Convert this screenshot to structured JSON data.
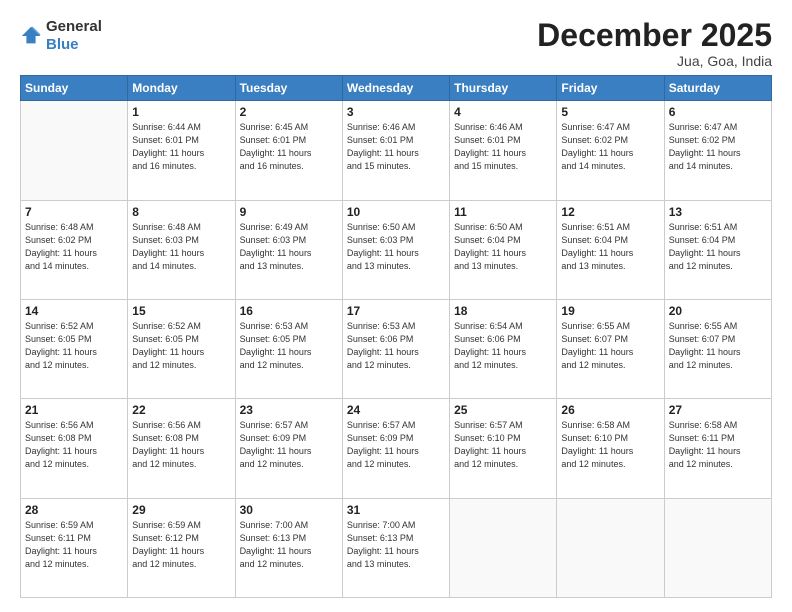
{
  "header": {
    "logo_general": "General",
    "logo_blue": "Blue",
    "month": "December 2025",
    "location": "Jua, Goa, India"
  },
  "weekdays": [
    "Sunday",
    "Monday",
    "Tuesday",
    "Wednesday",
    "Thursday",
    "Friday",
    "Saturday"
  ],
  "weeks": [
    [
      {
        "day": "",
        "info": ""
      },
      {
        "day": "1",
        "info": "Sunrise: 6:44 AM\nSunset: 6:01 PM\nDaylight: 11 hours\nand 16 minutes."
      },
      {
        "day": "2",
        "info": "Sunrise: 6:45 AM\nSunset: 6:01 PM\nDaylight: 11 hours\nand 16 minutes."
      },
      {
        "day": "3",
        "info": "Sunrise: 6:46 AM\nSunset: 6:01 PM\nDaylight: 11 hours\nand 15 minutes."
      },
      {
        "day": "4",
        "info": "Sunrise: 6:46 AM\nSunset: 6:01 PM\nDaylight: 11 hours\nand 15 minutes."
      },
      {
        "day": "5",
        "info": "Sunrise: 6:47 AM\nSunset: 6:02 PM\nDaylight: 11 hours\nand 14 minutes."
      },
      {
        "day": "6",
        "info": "Sunrise: 6:47 AM\nSunset: 6:02 PM\nDaylight: 11 hours\nand 14 minutes."
      }
    ],
    [
      {
        "day": "7",
        "info": "Sunrise: 6:48 AM\nSunset: 6:02 PM\nDaylight: 11 hours\nand 14 minutes."
      },
      {
        "day": "8",
        "info": "Sunrise: 6:48 AM\nSunset: 6:03 PM\nDaylight: 11 hours\nand 14 minutes."
      },
      {
        "day": "9",
        "info": "Sunrise: 6:49 AM\nSunset: 6:03 PM\nDaylight: 11 hours\nand 13 minutes."
      },
      {
        "day": "10",
        "info": "Sunrise: 6:50 AM\nSunset: 6:03 PM\nDaylight: 11 hours\nand 13 minutes."
      },
      {
        "day": "11",
        "info": "Sunrise: 6:50 AM\nSunset: 6:04 PM\nDaylight: 11 hours\nand 13 minutes."
      },
      {
        "day": "12",
        "info": "Sunrise: 6:51 AM\nSunset: 6:04 PM\nDaylight: 11 hours\nand 13 minutes."
      },
      {
        "day": "13",
        "info": "Sunrise: 6:51 AM\nSunset: 6:04 PM\nDaylight: 11 hours\nand 12 minutes."
      }
    ],
    [
      {
        "day": "14",
        "info": "Sunrise: 6:52 AM\nSunset: 6:05 PM\nDaylight: 11 hours\nand 12 minutes."
      },
      {
        "day": "15",
        "info": "Sunrise: 6:52 AM\nSunset: 6:05 PM\nDaylight: 11 hours\nand 12 minutes."
      },
      {
        "day": "16",
        "info": "Sunrise: 6:53 AM\nSunset: 6:05 PM\nDaylight: 11 hours\nand 12 minutes."
      },
      {
        "day": "17",
        "info": "Sunrise: 6:53 AM\nSunset: 6:06 PM\nDaylight: 11 hours\nand 12 minutes."
      },
      {
        "day": "18",
        "info": "Sunrise: 6:54 AM\nSunset: 6:06 PM\nDaylight: 11 hours\nand 12 minutes."
      },
      {
        "day": "19",
        "info": "Sunrise: 6:55 AM\nSunset: 6:07 PM\nDaylight: 11 hours\nand 12 minutes."
      },
      {
        "day": "20",
        "info": "Sunrise: 6:55 AM\nSunset: 6:07 PM\nDaylight: 11 hours\nand 12 minutes."
      }
    ],
    [
      {
        "day": "21",
        "info": "Sunrise: 6:56 AM\nSunset: 6:08 PM\nDaylight: 11 hours\nand 12 minutes."
      },
      {
        "day": "22",
        "info": "Sunrise: 6:56 AM\nSunset: 6:08 PM\nDaylight: 11 hours\nand 12 minutes."
      },
      {
        "day": "23",
        "info": "Sunrise: 6:57 AM\nSunset: 6:09 PM\nDaylight: 11 hours\nand 12 minutes."
      },
      {
        "day": "24",
        "info": "Sunrise: 6:57 AM\nSunset: 6:09 PM\nDaylight: 11 hours\nand 12 minutes."
      },
      {
        "day": "25",
        "info": "Sunrise: 6:57 AM\nSunset: 6:10 PM\nDaylight: 11 hours\nand 12 minutes."
      },
      {
        "day": "26",
        "info": "Sunrise: 6:58 AM\nSunset: 6:10 PM\nDaylight: 11 hours\nand 12 minutes."
      },
      {
        "day": "27",
        "info": "Sunrise: 6:58 AM\nSunset: 6:11 PM\nDaylight: 11 hours\nand 12 minutes."
      }
    ],
    [
      {
        "day": "28",
        "info": "Sunrise: 6:59 AM\nSunset: 6:11 PM\nDaylight: 11 hours\nand 12 minutes."
      },
      {
        "day": "29",
        "info": "Sunrise: 6:59 AM\nSunset: 6:12 PM\nDaylight: 11 hours\nand 12 minutes."
      },
      {
        "day": "30",
        "info": "Sunrise: 7:00 AM\nSunset: 6:13 PM\nDaylight: 11 hours\nand 12 minutes."
      },
      {
        "day": "31",
        "info": "Sunrise: 7:00 AM\nSunset: 6:13 PM\nDaylight: 11 hours\nand 13 minutes."
      },
      {
        "day": "",
        "info": ""
      },
      {
        "day": "",
        "info": ""
      },
      {
        "day": "",
        "info": ""
      }
    ]
  ]
}
